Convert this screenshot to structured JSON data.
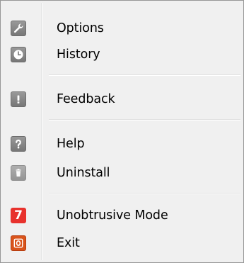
{
  "menu": {
    "items": [
      {
        "label": "Options",
        "icon": "wrench-icon"
      },
      {
        "label": "History",
        "icon": "clock-icon"
      },
      {
        "label": "Feedback",
        "icon": "exclamation-icon"
      },
      {
        "label": "Help",
        "icon": "question-icon"
      },
      {
        "label": "Uninstall",
        "icon": "trash-icon"
      },
      {
        "label": "Unobtrusive Mode",
        "icon": "seven-icon",
        "icon_text": "7"
      },
      {
        "label": "Exit",
        "icon": "power-icon"
      }
    ],
    "colors": {
      "background": "#f0f0f0",
      "icon_gray": "#888888",
      "seven_red": "#e8322d",
      "exit_orange": "#d9541b"
    }
  }
}
